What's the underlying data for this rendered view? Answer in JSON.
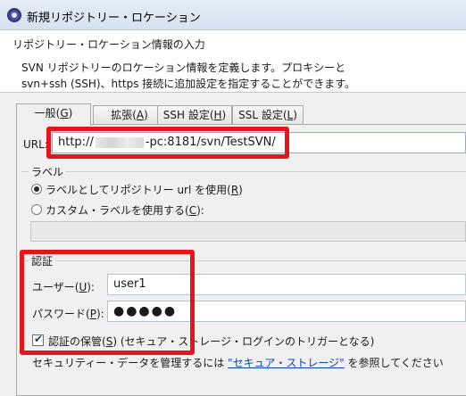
{
  "window": {
    "title": "新規リポジトリー・ロケーション",
    "icon": "eclipse-icon"
  },
  "banner": {
    "title": "リポジトリー・ロケーション情報の入力",
    "desc_line1": "SVN リポジトリーのロケーション情報を定義します。プロキシーと",
    "desc_line2": "svn+ssh (SSH)、https 接続に追加設定を指定することができます。"
  },
  "tabs": [
    {
      "label": "一般",
      "mnemonic": "G"
    },
    {
      "label": "拡張",
      "mnemonic": "A"
    },
    {
      "label": "SSH 設定",
      "mnemonic": "H"
    },
    {
      "label": "SSL 設定",
      "mnemonic": "L"
    }
  ],
  "url": {
    "label": "URL:",
    "value_prefix": "http://",
    "value_suffix": "-pc:8181/svn/TestSVN/"
  },
  "label_group": {
    "title": "ラベル",
    "option1": "ラベルとしてリポジトリー url を使用(",
    "option1_mnemonic": "R",
    "option2": "カスタム・ラベルを使用する(",
    "option2_mnemonic": "C",
    "selected": "option1"
  },
  "auth": {
    "title": "認証",
    "user_label": "ユーザー(",
    "user_mnemonic": "U",
    "user_value": "user1",
    "password_label": "パスワード(",
    "password_mnemonic": "P",
    "password_masked": "●●●●●",
    "save_label": "認証の保管(",
    "save_mnemonic": "S",
    "save_note": " (セキュア・ストレージ・ログインのトリガーとなる)",
    "save_checked": true,
    "secure_text_pre": "セキュリティー・データを管理するには ",
    "secure_link": "\"セキュア・ストレージ\"",
    "secure_text_post": " を参照してください"
  },
  "colors": {
    "highlight_red": "#e5161b",
    "link": "#0a46a8"
  }
}
